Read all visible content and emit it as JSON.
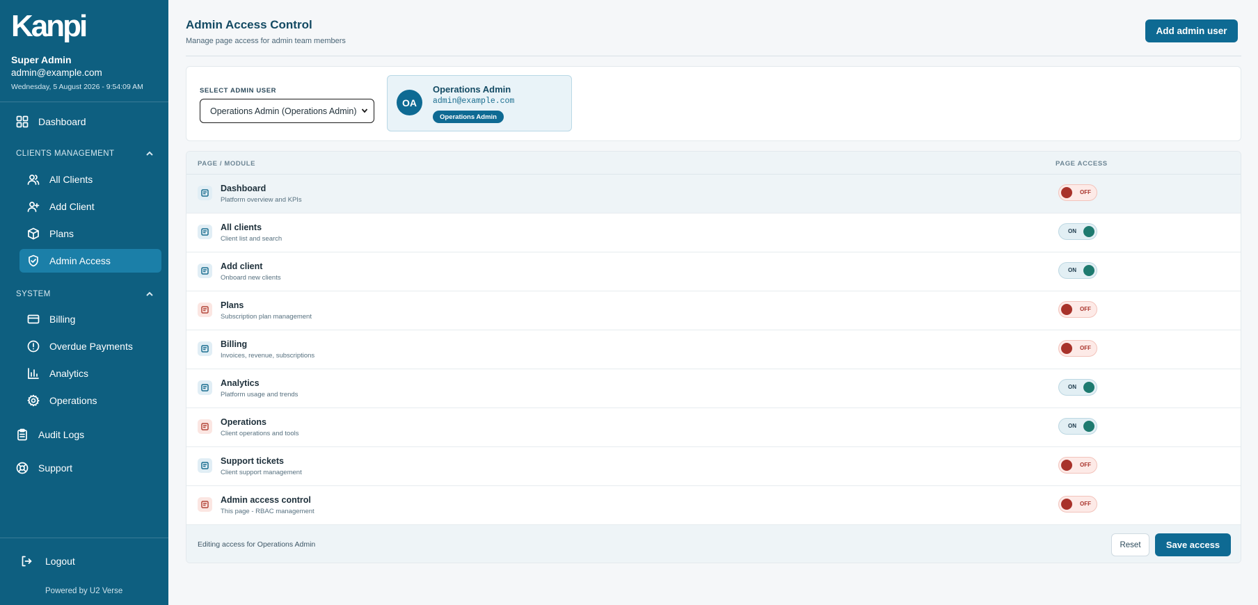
{
  "sidebar": {
    "logo_text": "Kanpi",
    "user_name": "Super Admin",
    "user_email": "admin@example.com",
    "datetime": "Wednesday, 5 August 2026 - 9:54:09 AM",
    "dashboard": "Dashboard",
    "clients_section": "CLIENTS MANAGEMENT",
    "all_clients": "All Clients",
    "add_client": "Add Client",
    "plans": "Plans",
    "admin_access": "Admin Access",
    "system_section": "SYSTEM",
    "billing": "Billing",
    "overdue_payments": "Overdue Payments",
    "analytics": "Analytics",
    "operations": "Operations",
    "audit_logs": "Audit Logs",
    "support": "Support",
    "logout": "Logout",
    "powered_by": "Powered by U2 Verse"
  },
  "header": {
    "title": "Admin Access Control",
    "subtitle": "Manage page access for admin team members",
    "add_button": "Add admin user"
  },
  "selector": {
    "label": "SELECT ADMIN USER",
    "value": "Operations Admin (Operations Admin)",
    "selected": {
      "initials": "OA",
      "name": "Operations Admin",
      "email": "admin@example.com",
      "role": "Operations Admin"
    }
  },
  "table": {
    "col_module": "PAGE / MODULE",
    "col_access": "PAGE ACCESS",
    "rows": [
      {
        "title": "Dashboard",
        "desc": "Platform overview and KPIs",
        "state": "OFF"
      },
      {
        "title": "All clients",
        "desc": "Client list and search",
        "state": "ON"
      },
      {
        "title": "Add client",
        "desc": "Onboard new clients",
        "state": "ON"
      },
      {
        "title": "Plans",
        "desc": "Subscription plan management",
        "state": "OFF"
      },
      {
        "title": "Billing",
        "desc": "Invoices, revenue, subscriptions",
        "state": "OFF"
      },
      {
        "title": "Analytics",
        "desc": "Platform usage and trends",
        "state": "ON"
      },
      {
        "title": "Operations",
        "desc": "Client operations and tools",
        "state": "ON"
      },
      {
        "title": "Support tickets",
        "desc": "Client support management",
        "state": "OFF"
      },
      {
        "title": "Admin access control",
        "desc": "This page - RBAC management",
        "state": "OFF"
      }
    ],
    "footer_text": "Editing access for Operations Admin",
    "reset_button": "Reset",
    "save_button": "Save access"
  },
  "colors": {
    "sidebar": "#0e5f80",
    "accent": "#0e6a93",
    "toggle_on": "#1e7a6f",
    "toggle_off": "#a8322a"
  }
}
